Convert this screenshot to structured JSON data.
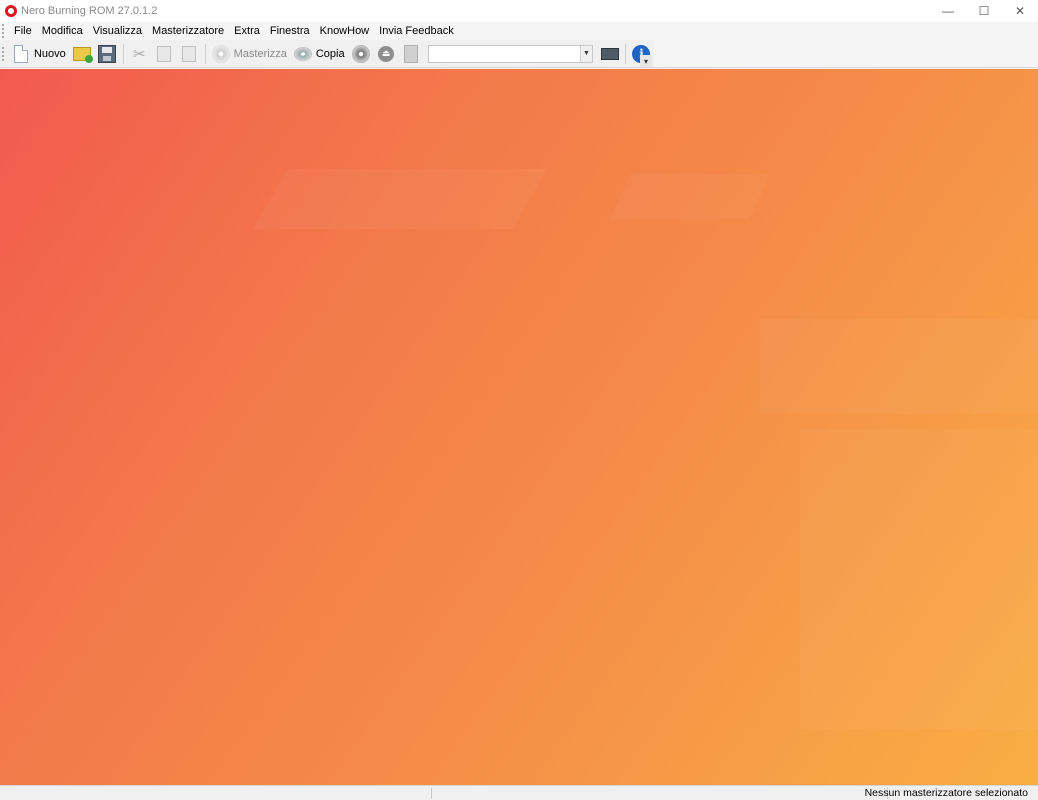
{
  "window": {
    "title": "Nero Burning ROM  27.0.1.2",
    "controls": {
      "minimize": "—",
      "maximize": "☐",
      "close": "✕"
    }
  },
  "menu": {
    "items": [
      "File",
      "Modifica",
      "Visualizza",
      "Masterizzatore",
      "Extra",
      "Finestra",
      "KnowHow",
      "Invia Feedback"
    ]
  },
  "toolbar": {
    "new_label": "Nuovo",
    "burn_label": "Masterizza",
    "copy_label": "Copia",
    "recorder_value": "",
    "overflow_glyph": "▾",
    "info_glyph": "i",
    "eject_glyph": "⏏",
    "cut_glyph": "✂"
  },
  "statusbar": {
    "recorder_status": "Nessun masterizzatore selezionato"
  },
  "colors": {
    "gradient_start": "#f25a4f",
    "gradient_end": "#f9ae44",
    "logo_red": "#d71920",
    "info_blue": "#1f63c4"
  }
}
